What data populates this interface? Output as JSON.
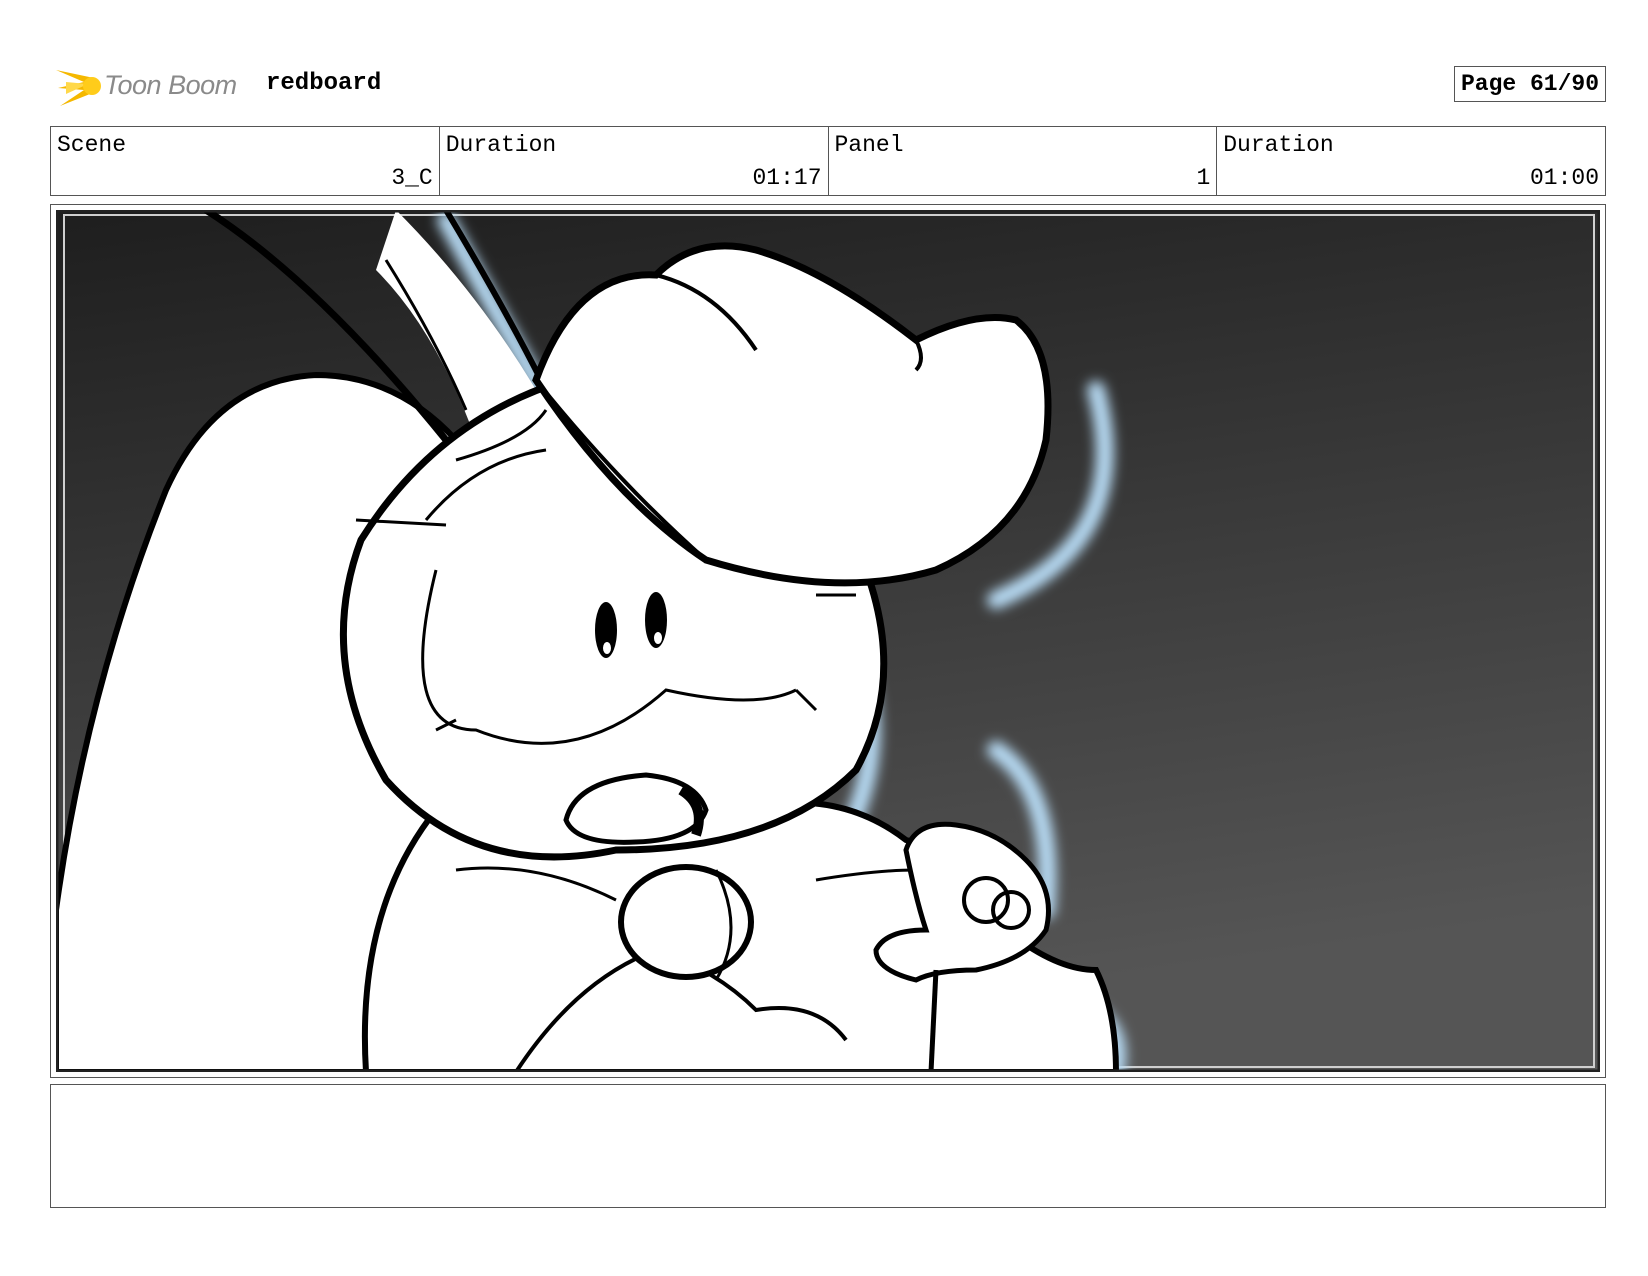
{
  "header": {
    "logo_text": "Toon Boom",
    "project_name": "redboard",
    "page_label": "Page 61/90"
  },
  "info": [
    {
      "label": "Scene",
      "value": "3_C"
    },
    {
      "label": "Duration",
      "value": "01:17"
    },
    {
      "label": "Panel",
      "value": "1"
    },
    {
      "label": "Duration",
      "value": "01:00"
    }
  ],
  "panel": {
    "image_kind": "storyboard-drawing",
    "background_gradient": [
      "#1e1e1e",
      "#555555"
    ],
    "highlight_color": "#b8dcf5"
  },
  "notes": {
    "text": ""
  },
  "colors": {
    "logo_flare": "#f5b800",
    "logo_text": "#8a8a8a",
    "border": "#555555"
  }
}
